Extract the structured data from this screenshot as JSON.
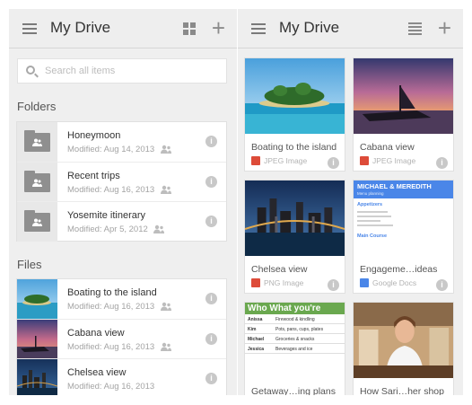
{
  "left_panel": {
    "title": "My Drive",
    "search_placeholder": "Search all items",
    "folders_label": "Folders",
    "files_label": "Files",
    "folders": [
      {
        "name": "Honeymoon",
        "modified": "Modified: Aug 14, 2013",
        "shared": true
      },
      {
        "name": "Recent trips",
        "modified": "Modified: Aug 16, 2013",
        "shared": true
      },
      {
        "name": "Yosemite itinerary",
        "modified": "Modified: Apr 5, 2012",
        "shared": true
      }
    ],
    "files": [
      {
        "name": "Boating to the island",
        "modified": "Modified: Aug 16, 2013"
      },
      {
        "name": "Cabana view",
        "modified": "Modified: Aug 16, 2013"
      },
      {
        "name": "Chelsea view",
        "modified": "Modified: Aug 16, 2013"
      }
    ]
  },
  "right_panel": {
    "title": "My Drive",
    "tiles": [
      {
        "name": "Boating to the island",
        "type": "JPEG Image"
      },
      {
        "name": "Cabana view",
        "type": "JPEG Image"
      },
      {
        "name": "Chelsea view",
        "type": "PNG Image"
      },
      {
        "name": "Engageme…ideas",
        "type": "Google Docs"
      },
      {
        "name": "Getaway…ing plans",
        "type": ""
      },
      {
        "name": "How Sari…her shop",
        "type": ""
      }
    ],
    "doc_preview": {
      "heading": "MICHAEL & MEREDITH",
      "subheading": "Menu planning",
      "appetizers": "Appetizers",
      "main_course": "Main Course"
    },
    "sheet_preview": {
      "header": "Who  What you're",
      "rows": [
        [
          "Anissa",
          "Firewood & kindling"
        ],
        [
          "Kim",
          "Pots, pans, cups, plates"
        ],
        [
          "Michael",
          "Groceries & snacks"
        ],
        [
          "Jessica",
          "Beverages and ice"
        ]
      ]
    }
  },
  "colors": {
    "image_badge": "#dd4b39",
    "docs_badge": "#4a86e8",
    "doc_heading_bg": "#4a86e8",
    "sheet_header_bg": "#6aa84f"
  },
  "icons": {
    "menu": "menu-icon",
    "grid": "grid-view-icon",
    "list": "list-view-icon",
    "add": "plus-icon",
    "search": "search-icon",
    "folder": "shared-folder-icon",
    "info": "info-icon",
    "shared": "people-icon"
  }
}
